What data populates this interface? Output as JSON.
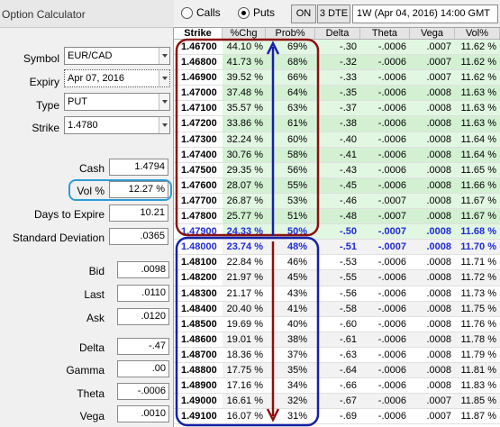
{
  "window_title": "Option Calculator",
  "inputs": {
    "symbol_label": "Symbol",
    "symbol_value": "EUR/CAD",
    "expiry_label": "Expiry",
    "expiry_value": "Apr 07, 2016",
    "type_label": "Type",
    "type_value": "PUT",
    "strike_label": "Strike",
    "strike_value": "1.4780",
    "cash_label": "Cash",
    "cash_value": "1.4794",
    "vol_label": "Vol %",
    "vol_value": "12.27 %",
    "days_label": "Days to Expire",
    "days_value": "10.21",
    "stddev_label": "Standard Deviation",
    "stddev_value": ".0365",
    "bid_label": "Bid",
    "bid_value": ".0098",
    "last_label": "Last",
    "last_value": ".0110",
    "ask_label": "Ask",
    "ask_value": ".0120",
    "delta_label": "Delta",
    "delta_value": "-.47",
    "gamma_label": "Gamma",
    "gamma_value": ".00",
    "theta_label": "Theta",
    "theta_value": "-.0006",
    "vega_label": "Vega",
    "vega_value": ".0010"
  },
  "toolbar": {
    "calls_label": "Calls",
    "puts_label": "Puts",
    "on_label": "ON",
    "dte_label": "3 DTE",
    "expiry_selector": "1W (Apr 04, 2016) 14:00 GMT",
    "selected_type": "Puts"
  },
  "table": {
    "headers": [
      "Strike",
      "%Chg",
      "Prob%",
      "Delta",
      "Theta",
      "Vega",
      "Vol%"
    ],
    "rows": [
      [
        "1.46700",
        "44.10 %",
        "69%",
        "-.30",
        "-.0006",
        ".0007",
        "11.62 %"
      ],
      [
        "1.46800",
        "41.73 %",
        "68%",
        "-.32",
        "-.0006",
        ".0007",
        "11.62 %"
      ],
      [
        "1.46900",
        "39.52 %",
        "66%",
        "-.33",
        "-.0006",
        ".0007",
        "11.62 %"
      ],
      [
        "1.47000",
        "37.48 %",
        "64%",
        "-.35",
        "-.0006",
        ".0008",
        "11.63 %"
      ],
      [
        "1.47100",
        "35.57 %",
        "63%",
        "-.37",
        "-.0006",
        ".0008",
        "11.63 %"
      ],
      [
        "1.47200",
        "33.86 %",
        "61%",
        "-.38",
        "-.0006",
        ".0008",
        "11.63 %"
      ],
      [
        "1.47300",
        "32.24 %",
        "60%",
        "-.40",
        "-.0006",
        ".0008",
        "11.64 %"
      ],
      [
        "1.47400",
        "30.76 %",
        "58%",
        "-.41",
        "-.0006",
        ".0008",
        "11.64 %"
      ],
      [
        "1.47500",
        "29.35 %",
        "56%",
        "-.43",
        "-.0006",
        ".0008",
        "11.65 %"
      ],
      [
        "1.47600",
        "28.07 %",
        "55%",
        "-.45",
        "-.0006",
        ".0008",
        "11.66 %"
      ],
      [
        "1.47700",
        "26.87 %",
        "53%",
        "-.46",
        "-.0007",
        ".0008",
        "11.67 %"
      ],
      [
        "1.47800",
        "25.77 %",
        "51%",
        "-.48",
        "-.0007",
        ".0008",
        "11.67 %"
      ],
      [
        "1.47900",
        "24.33 %",
        "50%",
        "-.50",
        "-.0007",
        ".0008",
        "11.68 %"
      ],
      [
        "1.48000",
        "23.74 %",
        "48%",
        "-.51",
        "-.0007",
        ".0008",
        "11.70 %"
      ],
      [
        "1.48100",
        "22.84 %",
        "46%",
        "-.53",
        "-.0006",
        ".0008",
        "11.71 %"
      ],
      [
        "1.48200",
        "21.97 %",
        "45%",
        "-.55",
        "-.0006",
        ".0008",
        "11.72 %"
      ],
      [
        "1.48300",
        "21.17 %",
        "43%",
        "-.56",
        "-.0006",
        ".0008",
        "11.73 %"
      ],
      [
        "1.48400",
        "20.40 %",
        "41%",
        "-.58",
        "-.0006",
        ".0008",
        "11.75 %"
      ],
      [
        "1.48500",
        "19.69 %",
        "40%",
        "-.60",
        "-.0006",
        ".0008",
        "11.76 %"
      ],
      [
        "1.48600",
        "19.01 %",
        "38%",
        "-.61",
        "-.0006",
        ".0008",
        "11.78 %"
      ],
      [
        "1.48700",
        "18.36 %",
        "37%",
        "-.63",
        "-.0006",
        ".0008",
        "11.79 %"
      ],
      [
        "1.48800",
        "17.75 %",
        "35%",
        "-.64",
        "-.0006",
        ".0008",
        "11.81 %"
      ],
      [
        "1.48900",
        "17.16 %",
        "34%",
        "-.66",
        "-.0006",
        ".0008",
        "11.83 %"
      ],
      [
        "1.49000",
        "16.61 %",
        "32%",
        "-.67",
        "-.0006",
        ".0007",
        "11.85 %"
      ],
      [
        "1.49100",
        "16.07 %",
        "31%",
        "-.69",
        "-.0006",
        ".0007",
        "11.87 %"
      ]
    ],
    "atm_strikes": [
      "1.47900",
      "1.48000"
    ],
    "itm_row_count": 13
  },
  "annotations": {
    "upper_box_color": "#8b1010",
    "lower_box_color": "#1420a8",
    "highlight_color": "#2e9bd6"
  }
}
